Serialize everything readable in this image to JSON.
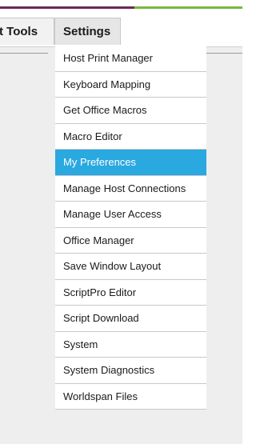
{
  "menubar": {
    "tools_label": "t Tools",
    "settings_label": "Settings"
  },
  "settings_menu": {
    "items": [
      {
        "label": "Host Print Manager"
      },
      {
        "label": "Keyboard Mapping"
      },
      {
        "label": "Get Office Macros"
      },
      {
        "label": "Macro Editor"
      },
      {
        "label": "My Preferences",
        "selected": true
      },
      {
        "label": "Manage Host Connections"
      },
      {
        "label": "Manage User Access"
      },
      {
        "label": "Office Manager"
      },
      {
        "label": "Save Window Layout"
      },
      {
        "label": "ScriptPro Editor"
      },
      {
        "label": "Script Download"
      },
      {
        "label": "System"
      },
      {
        "label": "System Diagnostics"
      },
      {
        "label": "Worldspan Files"
      }
    ]
  },
  "colors": {
    "selected_item": "#2aa8e0",
    "accent_purple": "#6a2a59",
    "accent_green": "#76b83a"
  }
}
